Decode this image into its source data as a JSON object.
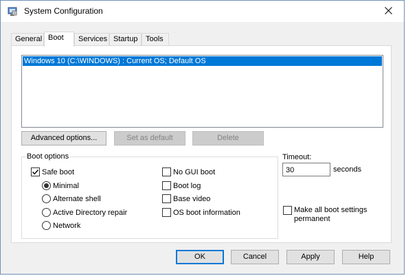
{
  "window": {
    "title": "System Configuration"
  },
  "tabs": [
    {
      "label": "General"
    },
    {
      "label": "Boot"
    },
    {
      "label": "Services"
    },
    {
      "label": "Startup"
    },
    {
      "label": "Tools"
    }
  ],
  "active_tab": "Boot",
  "os_list": {
    "items": [
      "Windows 10 (C:\\WINDOWS) : Current OS; Default OS"
    ],
    "selected_index": 0
  },
  "list_buttons": {
    "advanced": "Advanced options...",
    "set_default": "Set as default",
    "delete": "Delete"
  },
  "boot_options": {
    "legend": "Boot options",
    "safe_boot": {
      "label": "Safe boot",
      "checked": true
    },
    "safe_boot_modes": [
      {
        "label": "Minimal",
        "selected": true
      },
      {
        "label": "Alternate shell",
        "selected": false
      },
      {
        "label": "Active Directory repair",
        "selected": false
      },
      {
        "label": "Network",
        "selected": false
      }
    ],
    "flags": [
      {
        "label": "No GUI boot",
        "checked": false
      },
      {
        "label": "Boot log",
        "checked": false
      },
      {
        "label": "Base video",
        "checked": false
      },
      {
        "label": "OS boot information",
        "checked": false
      }
    ]
  },
  "timeout": {
    "label": "Timeout:",
    "value": "30",
    "unit": "seconds"
  },
  "make_permanent": {
    "line1": "Make all boot settings",
    "line2": "permanent",
    "checked": false
  },
  "dialog_buttons": {
    "ok": "OK",
    "cancel": "Cancel",
    "apply": "Apply",
    "help": "Help"
  },
  "colors": {
    "selection": "#0078d7",
    "accent": "#0078d7",
    "disabled_text": "#838383"
  },
  "icons": {
    "app": "system-config-icon",
    "close": "close-icon"
  }
}
